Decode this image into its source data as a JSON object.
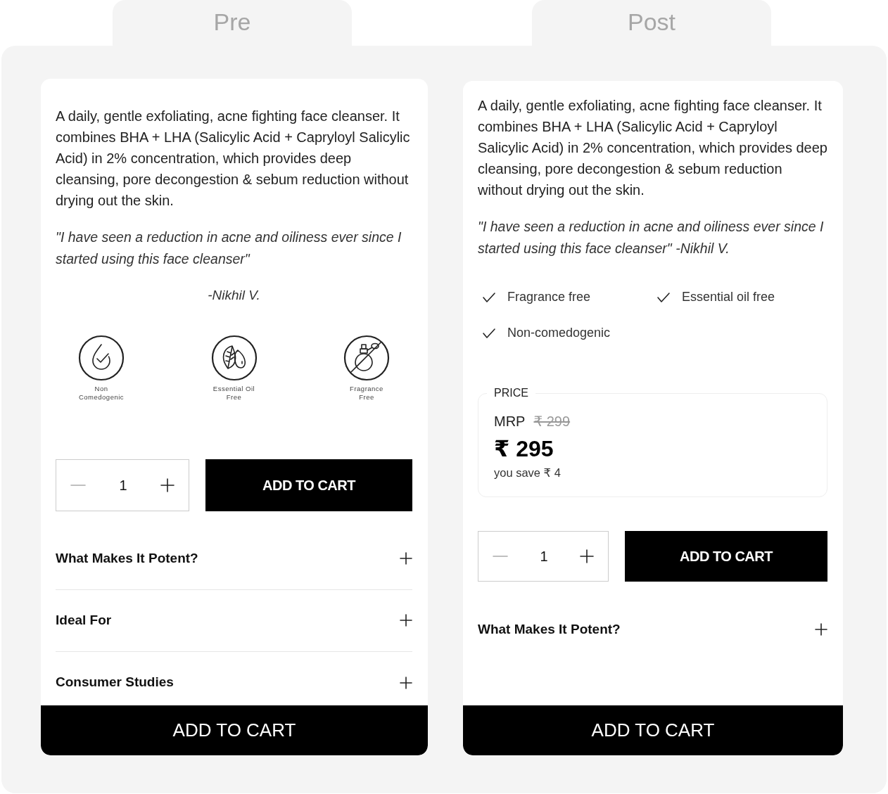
{
  "tabs": [
    {
      "label": "Pre"
    },
    {
      "label": "Post"
    }
  ],
  "panels": [
    {
      "description": "A daily, gentle exfoliating, acne fighting face cleanser. It combines BHA + LHA (Salicylic Acid + Capryloyl Salicylic Acid) in 2% concentration, which provides deep cleansing, pore decongestion & sebum reduction without drying out the skin.",
      "quote": "\"I have seen a reduction in acne and oiliness ever since I started using this face cleanser\"",
      "author": "-Nikhil V.",
      "badges": [
        {
          "kind": "drop",
          "label": "Non\nComedogenic"
        },
        {
          "kind": "leaf",
          "label": "Essential Oil\nFree"
        },
        {
          "kind": "bottle",
          "label": "Fragrance\nFree"
        }
      ],
      "quantity": "1",
      "add_button": "ADD TO CART",
      "accordion": [
        {
          "title": "What Makes It Potent?"
        },
        {
          "title": "Ideal For"
        },
        {
          "title": "Consumer Studies"
        }
      ],
      "sticky_button": "ADD TO CART"
    },
    {
      "description": "A daily, gentle exfoliating, acne fighting face cleanser. It combines BHA + LHA (Salicylic Acid + Capryloyl Salicylic Acid) in 2% concentration, which provides deep cleansing, pore decongestion & sebum reduction without drying out the skin.",
      "quote": "\"I have seen a reduction in acne and oiliness ever since I started using this face cleanser\" -Nikhil V.",
      "features": [
        "Fragrance free",
        "Essential oil free",
        "Non-comedogenic"
      ],
      "price": {
        "label": "PRICE",
        "mrp_label": "MRP",
        "mrp": "₹ 299",
        "amount": "₹ 295",
        "savings": "you save ₹ 4"
      },
      "quantity": "1",
      "add_button": "ADD TO CART",
      "accordion": [
        {
          "title": "What Makes It Potent?"
        }
      ],
      "sticky_button": "ADD TO CART"
    }
  ]
}
